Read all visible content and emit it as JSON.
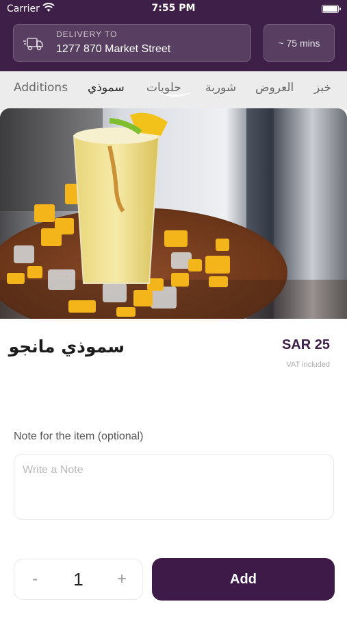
{
  "status_bar": {
    "carrier": "Carrier",
    "time": "7:55 PM"
  },
  "header": {
    "delivery_label": "DELIVERY TO",
    "delivery_address": "1277 870 Market Street",
    "eta": "~ 75 mins",
    "background_color": "#3d1f47"
  },
  "tabs": [
    {
      "label": "Additions"
    },
    {
      "label": "سموذي",
      "active": true
    },
    {
      "label": "حلويات"
    },
    {
      "label": "شوربة"
    },
    {
      "label": "العروض"
    },
    {
      "label": "خبز"
    }
  ],
  "product": {
    "name": "سموذي مانجو",
    "price": "SAR 25",
    "vat_note": "VAT included"
  },
  "note": {
    "label": "Note for the item (optional)",
    "placeholder": "Write a Note",
    "value": ""
  },
  "quantity": {
    "minus": "-",
    "value": "1",
    "plus": "+"
  },
  "add_button": {
    "label": "Add",
    "color": "#3d1a48"
  },
  "icons": [
    "wifi-icon",
    "battery-icon",
    "truck-icon",
    "tab-indicator-icon"
  ]
}
